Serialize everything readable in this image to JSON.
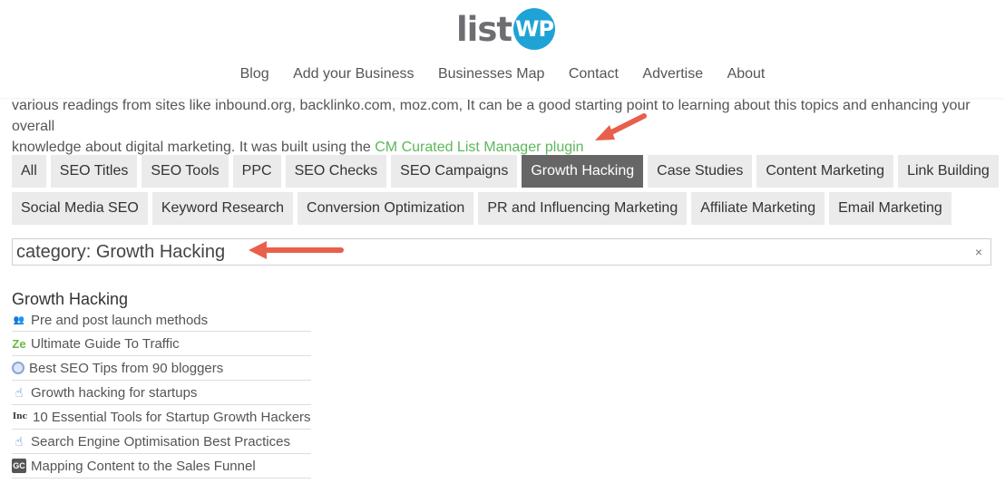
{
  "header": {
    "logo_text": "list",
    "logo_badge": "WP",
    "nav": [
      "Blog",
      "Add your Business",
      "Businesses Map",
      "Contact",
      "Advertise",
      "About"
    ]
  },
  "intro": {
    "line1": "various readings from sites like inbound.org, backlinko.com, moz.com, It can be a good starting point to learning about this topics and enhancing your overall",
    "line2_prefix": "knowledge about digital marketing. It was built using the ",
    "link_text": "CM Curated List Manager plugin"
  },
  "filters": {
    "row1": [
      "All",
      "SEO Titles",
      "SEO Tools",
      "PPC",
      "SEO Checks",
      "SEO Campaigns",
      "Growth Hacking",
      "Case Studies",
      "Content Marketing",
      "Link Building"
    ],
    "row2": [
      "Social Media SEO",
      "Keyword Research",
      "Conversion Optimization",
      "PR and Influencing Marketing",
      "Affiliate Marketing",
      "Email Marketing"
    ],
    "active": "Growth Hacking"
  },
  "search": {
    "value": "category: Growth Hacking",
    "clear_symbol": "×"
  },
  "category": {
    "title": "Growth Hacking",
    "items": [
      {
        "icon": "people-icon",
        "glyph": "👥",
        "label": "Pre and post launch methods"
      },
      {
        "icon": "ze-icon",
        "glyph": "Ze",
        "label": "Ultimate Guide To Traffic"
      },
      {
        "icon": "globe-icon",
        "glyph": "",
        "label": "Best SEO Tips from 90 bloggers"
      },
      {
        "icon": "pointer-hand-icon",
        "glyph": "☝",
        "label": "Growth hacking for startups"
      },
      {
        "icon": "inc-icon",
        "glyph": "Inc",
        "label": "10 Essential Tools for Startup Growth Hackers"
      },
      {
        "icon": "pointer-hand-icon",
        "glyph": "☝",
        "label": "Search Engine Optimisation Best Practices"
      },
      {
        "icon": "gc-icon",
        "glyph": "GC",
        "label": "Mapping Content to the Sales Funnel"
      }
    ]
  },
  "colors": {
    "accent_green": "#5cb85c",
    "active_filter": "#666666",
    "arrow": "#e8604c",
    "logo_blue": "#1fa3d6"
  }
}
